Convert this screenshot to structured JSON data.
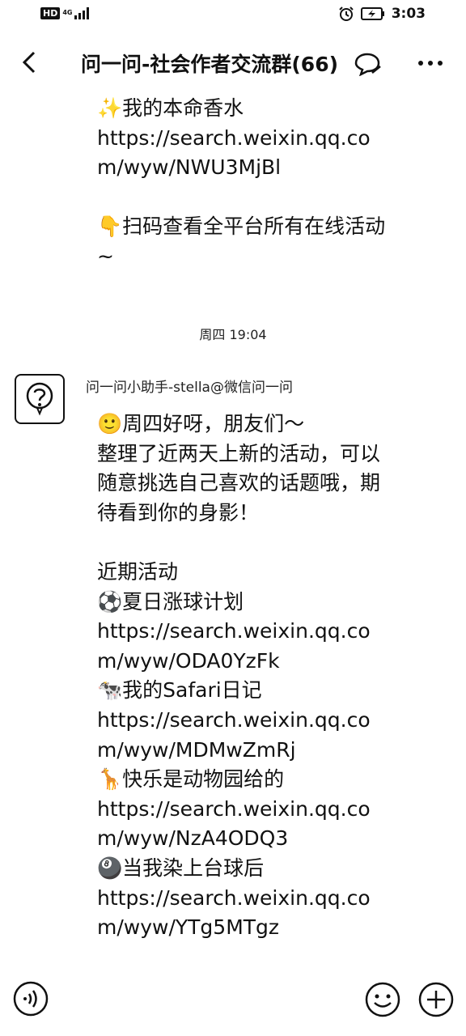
{
  "status_bar": {
    "hd": "HD",
    "network": "4G",
    "time": "3:03"
  },
  "header": {
    "title": "问一问-社会作者交流群(66)"
  },
  "previous_message": {
    "text": "✨我的本命香水\nhttps://search.weixin.qq.com/wyw/NWU3MjBl\n\n👇扫码查看全平台所有在线活动~"
  },
  "timestamp": "周四 19:04",
  "message": {
    "sender": "问一问小助手-stella@微信问一问",
    "text": "🙂周四好呀，朋友们～\n整理了近两天上新的活动，可以随意挑选自己喜欢的话题哦，期待看到你的身影！\n\n近期活动\n⚽夏日涨球计划\nhttps://search.weixin.qq.com/wyw/ODA0YzFk\n🐄我的Safari日记\nhttps://search.weixin.qq.com/wyw/MDMwZmRj\n🦒快乐是动物园给的\nhttps://search.weixin.qq.com/wyw/NzA4ODQ3\n🎱当我染上台球后\nhttps://search.weixin.qq.com/wyw/YTg5MTgz"
  }
}
